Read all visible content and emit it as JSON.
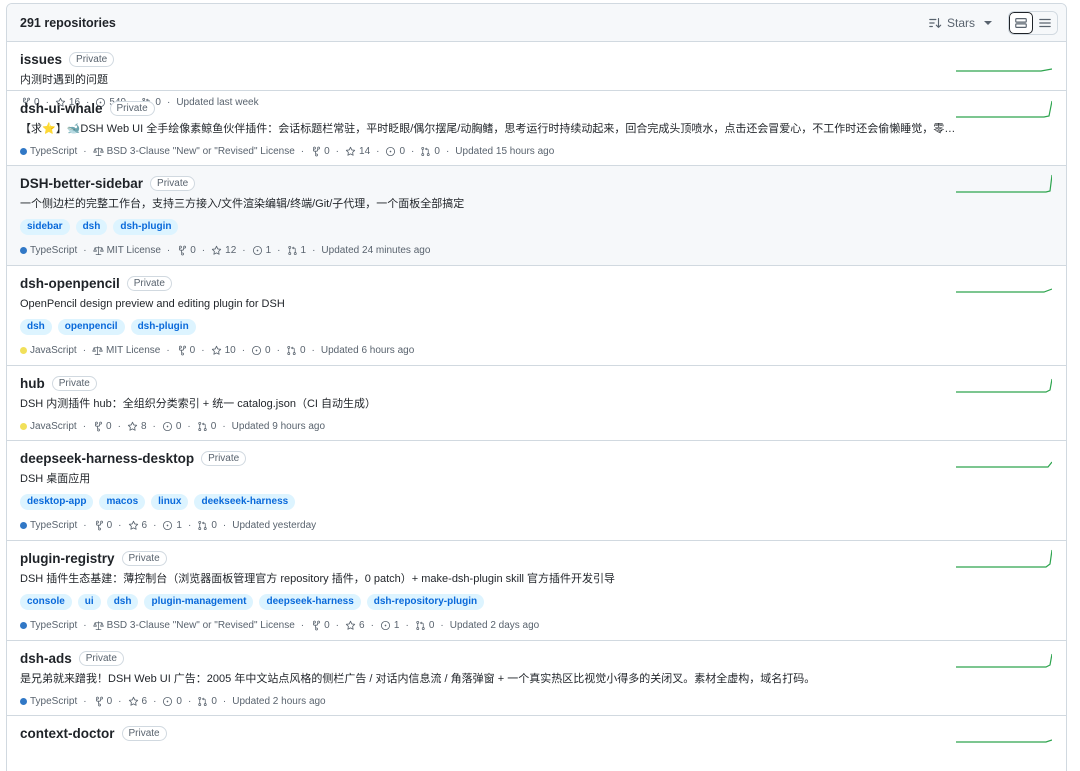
{
  "header": {
    "count": "291 repositories",
    "sort_label": "Stars"
  },
  "colors": {
    "TypeScript": "#3178c6",
    "JavaScript": "#f1e05a",
    "spark": "#2da44e"
  },
  "repos": [
    {
      "name": "issues",
      "badge": "Private",
      "desc": "内测时遇到的问题",
      "topics": [],
      "language": "",
      "license": "",
      "forks": "0",
      "stars": "16",
      "issues": "549",
      "prs": "0",
      "updated": "Updated last week"
    },
    {
      "name": "dsh-ui-whale",
      "badge": "Private",
      "desc": "【求⭐】🐋DSH Web UI 全手绘像素鲸鱼伙伴插件：会话标题栏常驻，平时眨眼/偶尔摆尾/动胸鳍，思考运行时持续动起来，回合完成头顶喷水，点击还会冒爱心，不工作时还会偷懒睡觉，零核…",
      "topics": [],
      "language": "TypeScript",
      "license": "BSD 3-Clause \"New\" or \"Revised\" License",
      "forks": "0",
      "stars": "14",
      "issues": "0",
      "prs": "0",
      "updated": "Updated 15 hours ago"
    },
    {
      "name": "DSH-better-sidebar",
      "badge": "Private",
      "desc": "一个侧边栏的完整工作台，支持三方接入/文件渲染编辑/终端/Git/子代理，一个面板全部搞定",
      "topics": [
        "sidebar",
        "dsh",
        "dsh-plugin"
      ],
      "language": "TypeScript",
      "license": "MIT License",
      "forks": "0",
      "stars": "12",
      "issues": "1",
      "prs": "1",
      "updated": "Updated 24 minutes ago"
    },
    {
      "name": "dsh-openpencil",
      "badge": "Private",
      "desc": "OpenPencil design preview and editing plugin for DSH",
      "topics": [
        "dsh",
        "openpencil",
        "dsh-plugin"
      ],
      "language": "JavaScript",
      "license": "MIT License",
      "forks": "0",
      "stars": "10",
      "issues": "0",
      "prs": "0",
      "updated": "Updated 6 hours ago"
    },
    {
      "name": "hub",
      "badge": "Private",
      "desc": "DSH 内测插件 hub：全组织分类索引 + 统一 catalog.json（CI 自动生成）",
      "topics": [],
      "language": "JavaScript",
      "license": "",
      "forks": "0",
      "stars": "8",
      "issues": "0",
      "prs": "0",
      "updated": "Updated 9 hours ago"
    },
    {
      "name": "deepseek-harness-desktop",
      "badge": "Private",
      "desc": "DSH 桌面应用",
      "topics": [
        "desktop-app",
        "macos",
        "linux",
        "deekseek-harness"
      ],
      "language": "TypeScript",
      "license": "",
      "forks": "0",
      "stars": "6",
      "issues": "1",
      "prs": "0",
      "updated": "Updated yesterday"
    },
    {
      "name": "plugin-registry",
      "badge": "Private",
      "desc": "DSH 插件生态基建：薄控制台（浏览器面板管理官方 repository 插件，0 patch）+ make-dsh-plugin skill 官方插件开发引导",
      "topics": [
        "console",
        "ui",
        "dsh",
        "plugin-management",
        "deepseek-harness",
        "dsh-repository-plugin"
      ],
      "language": "TypeScript",
      "license": "BSD 3-Clause \"New\" or \"Revised\" License",
      "forks": "0",
      "stars": "6",
      "issues": "1",
      "prs": "0",
      "updated": "Updated 2 days ago"
    },
    {
      "name": "dsh-ads",
      "badge": "Private",
      "desc": "是兄弟就来蹭我！DSH Web UI 广告：2005 年中文站点风格的侧栏广告 / 对话内信息流 / 角落弹窗 + 一个真实热区比视觉小得多的关闭叉。素材全虚构，域名打码。",
      "topics": [],
      "language": "TypeScript",
      "license": "",
      "forks": "0",
      "stars": "6",
      "issues": "0",
      "prs": "0",
      "updated": "Updated 2 hours ago"
    },
    {
      "name": "context-doctor",
      "badge": "Private",
      "desc": "",
      "topics": [],
      "language": "",
      "license": "",
      "forks": "",
      "stars": "",
      "issues": "",
      "prs": "",
      "updated": ""
    }
  ]
}
